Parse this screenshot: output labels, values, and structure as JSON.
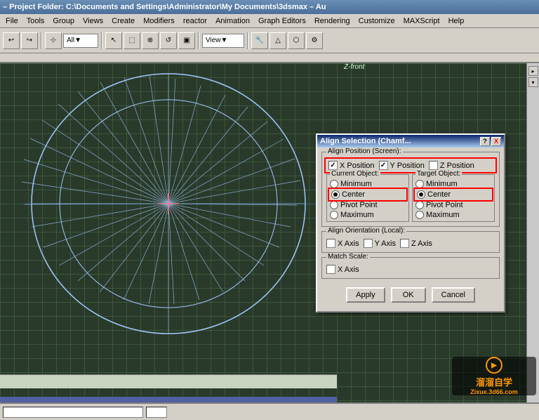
{
  "titleBar": {
    "text": " – Project Folder: C:\\Documents and Settings\\Administrator\\My Documents\\3dsmax – Au"
  },
  "menuBar": {
    "items": [
      "File",
      "Tools",
      "Group",
      "Views",
      "Create",
      "Modifiers",
      "reactor",
      "Animation",
      "Graph Editors",
      "Rendering",
      "Customize",
      "MAXScript",
      "Help"
    ]
  },
  "toolbar": {
    "dropdown": "All",
    "viewMode": "View"
  },
  "viewport": {
    "label": "Z-front"
  },
  "dialog": {
    "title": "Align Selection (Chamf...",
    "helpBtn": "?",
    "closeBtn": "X",
    "alignPosition": {
      "groupTitle": "Align Position (Screen):",
      "xPosition": {
        "label": "X Position",
        "checked": true
      },
      "yPosition": {
        "label": "Y Position",
        "checked": true
      },
      "zPosition": {
        "label": "Z Position",
        "checked": false
      }
    },
    "currentObject": {
      "groupTitle": "Current Object:",
      "minimum": {
        "label": "Minimum",
        "selected": false
      },
      "center": {
        "label": "Center",
        "selected": true
      },
      "pivotPoint": {
        "label": "Pivot Point",
        "selected": false
      },
      "maximum": {
        "label": "Maximum",
        "selected": false
      }
    },
    "targetObject": {
      "groupTitle": "Target Object:",
      "minimum": {
        "label": "Minimum",
        "selected": false
      },
      "center": {
        "label": "Center",
        "selected": true
      },
      "pivotPoint": {
        "label": "Pivot Point",
        "selected": false
      },
      "maximum": {
        "label": "Maximum",
        "selected": false
      }
    },
    "alignOrientation": {
      "groupTitle": "Align Orientation (Local):",
      "xAxis": {
        "label": "X Axis",
        "checked": false
      },
      "yAxis": {
        "label": "Y Axis",
        "checked": false
      },
      "zAxis": {
        "label": "Z Axis",
        "checked": false
      }
    },
    "matchScale": {
      "groupTitle": "Match Scale:",
      "xAxis": {
        "label": "X Axis",
        "checked": false
      }
    },
    "buttons": {
      "apply": "Apply",
      "ok": "OK",
      "cancel": "Cancel"
    }
  },
  "watermark": {
    "line1": "溜溜自学",
    "line2": "Zixue.3d66.com"
  },
  "icons": {
    "play": "▶"
  }
}
